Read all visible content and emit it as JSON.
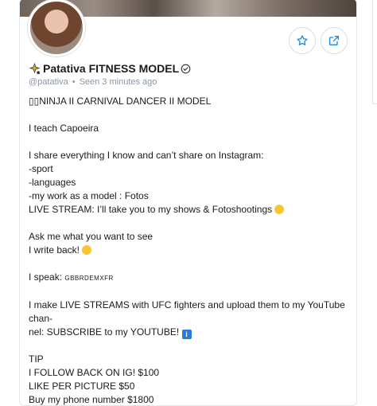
{
  "profile": {
    "display_name": "Patativa FITNESS MODEL",
    "username": "@patativa",
    "seen": "Seen 3 minutes ago",
    "separator": "•"
  },
  "actions": {
    "favorite_icon": "star-icon",
    "share_icon": "share-icon",
    "accent_color": "#1e88e5"
  },
  "bio": {
    "line1": "▯▯NINJA II CARNIVAL DANCER II MODEL",
    "line2": "I teach Capoeira",
    "line3": "I share everything I know and can’t share on Instagram:",
    "line4": "-sport",
    "line5": "-languages",
    "line6": "-my work as a model : Fotos",
    "line7": "LIVE STREAM: I’ll take you to my shows & Fotoshootings",
    "line8": "Ask me what you want to see",
    "line9": "I write back!",
    "line10_label": "I speak:",
    "line10_langs": "GBBRDEMXFR",
    "line11": "I make LIVE STREAMS with UFC fighters and upload them to my YouTube chan-",
    "line12": "nel: SUBSCRIBE to my YOUTUBE!",
    "line13": "TIP",
    "line14": "I FOLLOW BACK ON IG! $100",
    "line15": "LIKE PER PICTURE $50",
    "line16": "Buy my phone number $1800"
  }
}
